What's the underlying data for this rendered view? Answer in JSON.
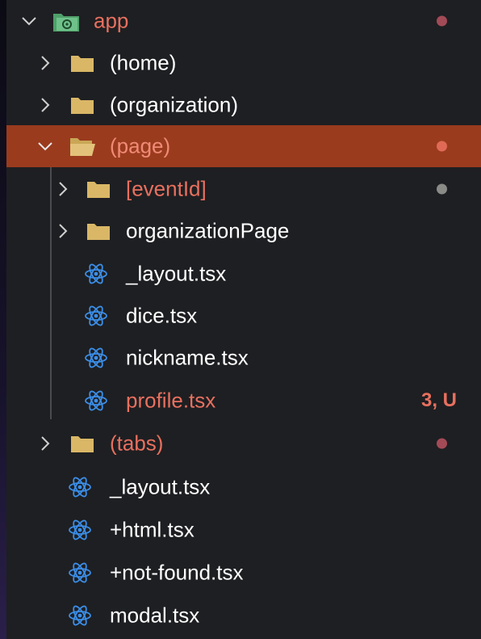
{
  "colors": {
    "panel_bg": "#1e1f22",
    "selected_bg": "#9a3b1e",
    "text": "#ffffff",
    "modified_text": "#e8705f",
    "folder": "#d9b766",
    "react_icon": "#3b8ee8",
    "dot_modified": "#a34a57",
    "dot_selected": "#e06a55",
    "dot_neutral": "#8a8a86"
  },
  "tree": {
    "app_label": "app",
    "home_label": "(home)",
    "organization_label": "(organization)",
    "page_label": "(page)",
    "eventid_label": "[eventId]",
    "organizationpage_label": "organizationPage",
    "page_layout_label": "_layout.tsx",
    "dice_label": "dice.tsx",
    "nickname_label": "nickname.tsx",
    "profile_label": "profile.tsx",
    "profile_badge": "3, U",
    "tabs_label": "(tabs)",
    "root_layout_label": "_layout.tsx",
    "html_label": "+html.tsx",
    "notfound_label": "+not-found.tsx",
    "modal_label": "modal.tsx"
  },
  "icons": {
    "expanded": "chevron-down-icon",
    "collapsed": "chevron-right-icon",
    "folder": "folder-icon",
    "open_folder": "folder-open-icon",
    "app_folder": "app-folder-icon",
    "file": "react-file-icon"
  }
}
